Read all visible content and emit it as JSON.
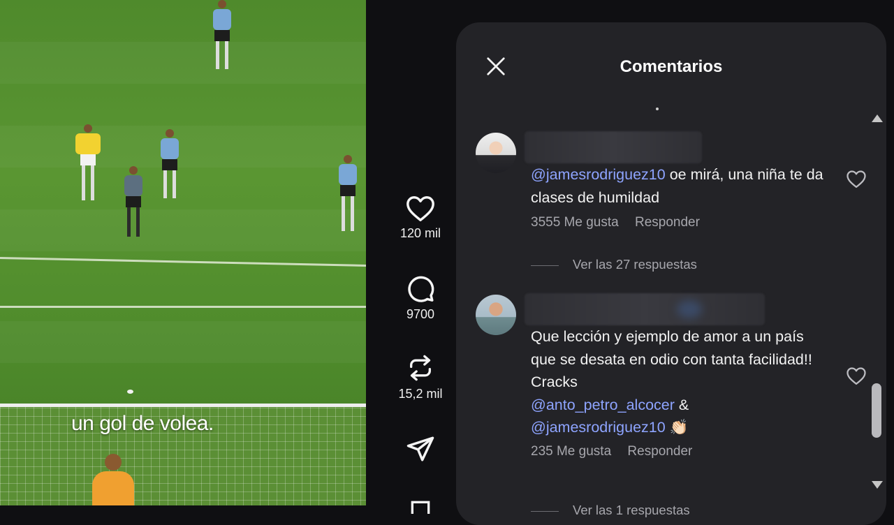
{
  "video": {
    "subtitle": "un gol de volea."
  },
  "actions": {
    "likes": "120 mil",
    "comments": "9700",
    "reposts": "15,2 mil"
  },
  "panel": {
    "title": "Comentarios",
    "comments": [
      {
        "mention": "@jamesrodriguez10",
        "text": " oe mirá, una niña te da clases de humildad",
        "likes": "3555 Me gusta",
        "reply": "Responder",
        "view_replies": "Ver las 27 respuestas"
      },
      {
        "text": "Que lección y ejemplo de amor a un país que se desata en odio con tanta facilidad!! Cracks ",
        "mention1": "@anto_petro_alcocer",
        "amp": " & ",
        "mention2": "@jamesrodriguez10",
        "emoji": " 👏🏻",
        "likes": "235 Me gusta",
        "reply": "Responder",
        "view_replies": "Ver las 1 respuestas"
      }
    ]
  },
  "icons": {
    "close": "close-icon",
    "like": "heart-icon",
    "comment": "comment-icon",
    "repost": "repost-icon",
    "share": "send-icon"
  }
}
